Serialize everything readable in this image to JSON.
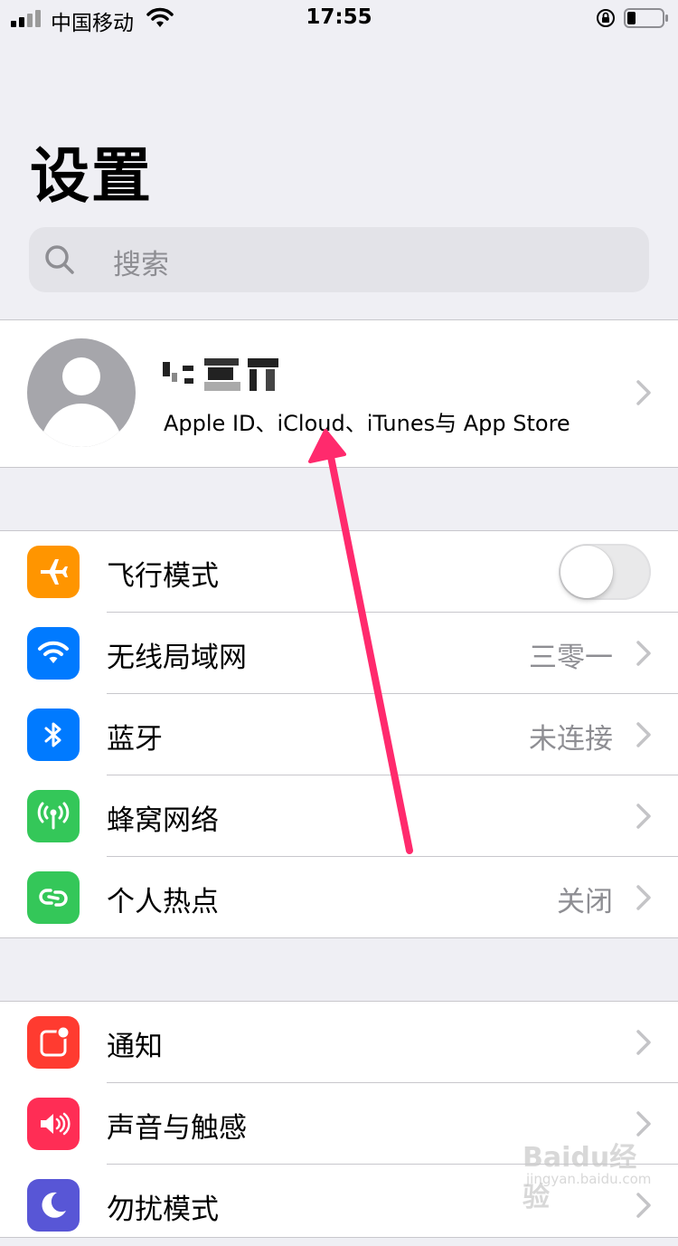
{
  "status_bar": {
    "carrier": "中国移动",
    "time": "17:55"
  },
  "header": {
    "title": "设置"
  },
  "search": {
    "placeholder": "搜索"
  },
  "profile": {
    "subtitle": "Apple ID、iCloud、iTunes与 App Store"
  },
  "connectivity": [
    {
      "label": "飞行模式",
      "icon": "airplane-icon",
      "color": "#ff9500",
      "toggle": false
    },
    {
      "label": "无线局域网",
      "icon": "wifi-icon",
      "color": "#007aff",
      "value": "三零一"
    },
    {
      "label": "蓝牙",
      "icon": "bluetooth-icon",
      "color": "#007aff",
      "value": "未连接"
    },
    {
      "label": "蜂窝网络",
      "icon": "cellular-icon",
      "color": "#34c759"
    },
    {
      "label": "个人热点",
      "icon": "hotspot-icon",
      "color": "#34c759",
      "value": "关闭"
    }
  ],
  "notifications": [
    {
      "label": "通知",
      "icon": "notifications-icon",
      "color": "#ff3b30"
    },
    {
      "label": "声音与触感",
      "icon": "sound-icon",
      "color": "#ff2d55"
    },
    {
      "label": "勿扰模式",
      "icon": "moon-icon",
      "color": "#5856d6"
    }
  ],
  "annotation": {
    "arrow_color": "#ff2a6d"
  },
  "watermark": {
    "brand": "Baidu经验",
    "url": "jingyan.baidu.com"
  }
}
